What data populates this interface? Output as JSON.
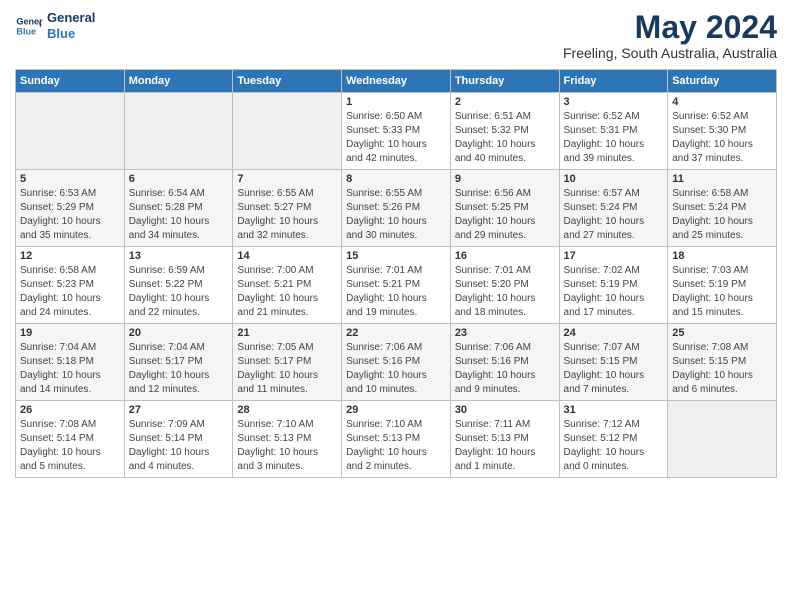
{
  "header": {
    "logo_line1": "General",
    "logo_line2": "Blue",
    "title": "May 2024",
    "subtitle": "Freeling, South Australia, Australia"
  },
  "calendar": {
    "weekdays": [
      "Sunday",
      "Monday",
      "Tuesday",
      "Wednesday",
      "Thursday",
      "Friday",
      "Saturday"
    ],
    "weeks": [
      [
        {
          "day": "",
          "info": ""
        },
        {
          "day": "",
          "info": ""
        },
        {
          "day": "",
          "info": ""
        },
        {
          "day": "1",
          "info": "Sunrise: 6:50 AM\nSunset: 5:33 PM\nDaylight: 10 hours\nand 42 minutes."
        },
        {
          "day": "2",
          "info": "Sunrise: 6:51 AM\nSunset: 5:32 PM\nDaylight: 10 hours\nand 40 minutes."
        },
        {
          "day": "3",
          "info": "Sunrise: 6:52 AM\nSunset: 5:31 PM\nDaylight: 10 hours\nand 39 minutes."
        },
        {
          "day": "4",
          "info": "Sunrise: 6:52 AM\nSunset: 5:30 PM\nDaylight: 10 hours\nand 37 minutes."
        }
      ],
      [
        {
          "day": "5",
          "info": "Sunrise: 6:53 AM\nSunset: 5:29 PM\nDaylight: 10 hours\nand 35 minutes."
        },
        {
          "day": "6",
          "info": "Sunrise: 6:54 AM\nSunset: 5:28 PM\nDaylight: 10 hours\nand 34 minutes."
        },
        {
          "day": "7",
          "info": "Sunrise: 6:55 AM\nSunset: 5:27 PM\nDaylight: 10 hours\nand 32 minutes."
        },
        {
          "day": "8",
          "info": "Sunrise: 6:55 AM\nSunset: 5:26 PM\nDaylight: 10 hours\nand 30 minutes."
        },
        {
          "day": "9",
          "info": "Sunrise: 6:56 AM\nSunset: 5:25 PM\nDaylight: 10 hours\nand 29 minutes."
        },
        {
          "day": "10",
          "info": "Sunrise: 6:57 AM\nSunset: 5:24 PM\nDaylight: 10 hours\nand 27 minutes."
        },
        {
          "day": "11",
          "info": "Sunrise: 6:58 AM\nSunset: 5:24 PM\nDaylight: 10 hours\nand 25 minutes."
        }
      ],
      [
        {
          "day": "12",
          "info": "Sunrise: 6:58 AM\nSunset: 5:23 PM\nDaylight: 10 hours\nand 24 minutes."
        },
        {
          "day": "13",
          "info": "Sunrise: 6:59 AM\nSunset: 5:22 PM\nDaylight: 10 hours\nand 22 minutes."
        },
        {
          "day": "14",
          "info": "Sunrise: 7:00 AM\nSunset: 5:21 PM\nDaylight: 10 hours\nand 21 minutes."
        },
        {
          "day": "15",
          "info": "Sunrise: 7:01 AM\nSunset: 5:21 PM\nDaylight: 10 hours\nand 19 minutes."
        },
        {
          "day": "16",
          "info": "Sunrise: 7:01 AM\nSunset: 5:20 PM\nDaylight: 10 hours\nand 18 minutes."
        },
        {
          "day": "17",
          "info": "Sunrise: 7:02 AM\nSunset: 5:19 PM\nDaylight: 10 hours\nand 17 minutes."
        },
        {
          "day": "18",
          "info": "Sunrise: 7:03 AM\nSunset: 5:19 PM\nDaylight: 10 hours\nand 15 minutes."
        }
      ],
      [
        {
          "day": "19",
          "info": "Sunrise: 7:04 AM\nSunset: 5:18 PM\nDaylight: 10 hours\nand 14 minutes."
        },
        {
          "day": "20",
          "info": "Sunrise: 7:04 AM\nSunset: 5:17 PM\nDaylight: 10 hours\nand 12 minutes."
        },
        {
          "day": "21",
          "info": "Sunrise: 7:05 AM\nSunset: 5:17 PM\nDaylight: 10 hours\nand 11 minutes."
        },
        {
          "day": "22",
          "info": "Sunrise: 7:06 AM\nSunset: 5:16 PM\nDaylight: 10 hours\nand 10 minutes."
        },
        {
          "day": "23",
          "info": "Sunrise: 7:06 AM\nSunset: 5:16 PM\nDaylight: 10 hours\nand 9 minutes."
        },
        {
          "day": "24",
          "info": "Sunrise: 7:07 AM\nSunset: 5:15 PM\nDaylight: 10 hours\nand 7 minutes."
        },
        {
          "day": "25",
          "info": "Sunrise: 7:08 AM\nSunset: 5:15 PM\nDaylight: 10 hours\nand 6 minutes."
        }
      ],
      [
        {
          "day": "26",
          "info": "Sunrise: 7:08 AM\nSunset: 5:14 PM\nDaylight: 10 hours\nand 5 minutes."
        },
        {
          "day": "27",
          "info": "Sunrise: 7:09 AM\nSunset: 5:14 PM\nDaylight: 10 hours\nand 4 minutes."
        },
        {
          "day": "28",
          "info": "Sunrise: 7:10 AM\nSunset: 5:13 PM\nDaylight: 10 hours\nand 3 minutes."
        },
        {
          "day": "29",
          "info": "Sunrise: 7:10 AM\nSunset: 5:13 PM\nDaylight: 10 hours\nand 2 minutes."
        },
        {
          "day": "30",
          "info": "Sunrise: 7:11 AM\nSunset: 5:13 PM\nDaylight: 10 hours\nand 1 minute."
        },
        {
          "day": "31",
          "info": "Sunrise: 7:12 AM\nSunset: 5:12 PM\nDaylight: 10 hours\nand 0 minutes."
        },
        {
          "day": "",
          "info": ""
        }
      ]
    ]
  }
}
